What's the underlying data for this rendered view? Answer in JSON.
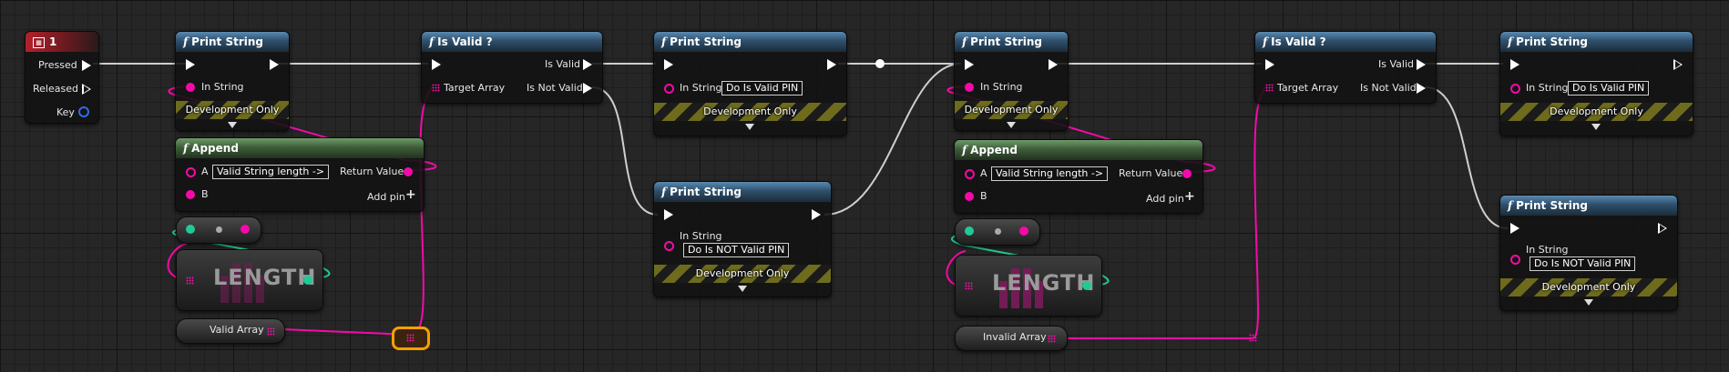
{
  "graph_title": "Blueprint Event Graph",
  "key_event": {
    "title": "1",
    "pins": [
      "Pressed",
      "Released",
      "Key"
    ]
  },
  "print_strings": [
    {
      "title": "Print String",
      "in_string": "In String",
      "dev_only": "Development Only"
    },
    {
      "title": "Print String",
      "in_string": "In String",
      "value": "Do Is Valid PIN",
      "dev_only": "Development Only"
    },
    {
      "title": "Print String",
      "in_string": "In String",
      "value": "Do Is NOT Valid PIN",
      "dev_only": "Development Only"
    },
    {
      "title": "Print String",
      "in_string": "In String",
      "dev_only": "Development Only"
    },
    {
      "title": "Print String",
      "in_string": "In String",
      "value": "Do Is Valid PIN",
      "dev_only": "Development Only"
    },
    {
      "title": "Print String",
      "in_string": "In String",
      "value": "Do Is NOT Valid PIN",
      "dev_only": "Development Only"
    }
  ],
  "is_valid_nodes": [
    {
      "title": "Is Valid ?",
      "target": "Target Array",
      "out_valid": "Is Valid",
      "out_not_valid": "Is Not Valid"
    },
    {
      "title": "Is Valid ?",
      "target": "Target Array",
      "out_valid": "Is Valid",
      "out_not_valid": "Is Not Valid"
    }
  ],
  "append_nodes": [
    {
      "title": "Append",
      "a_label": "A",
      "a_value": "Valid String length ->",
      "b_label": "B",
      "return_label": "Return Value",
      "add_pin": "Add pin"
    },
    {
      "title": "Append",
      "a_label": "A",
      "a_value": "Valid String length ->",
      "b_label": "B",
      "return_label": "Return Value",
      "add_pin": "Add pin"
    }
  ],
  "length_nodes": [
    {
      "label": "LENGTH"
    },
    {
      "label": "LENGTH"
    }
  ],
  "variables": [
    {
      "name": "Valid Array"
    },
    {
      "name": "Invalid Array"
    }
  ],
  "colors": {
    "exec": "#ffffff",
    "string": "#f40aa8",
    "int": "#21c997",
    "struct": "#2f6ae8",
    "reroute": "#f4a000",
    "dev_stripe": "#6e6b1d"
  },
  "icons": [
    "function-icon",
    "keyboard-key-icon",
    "array-grid-icon",
    "add-pin-icon",
    "exec-pin-icon"
  ]
}
